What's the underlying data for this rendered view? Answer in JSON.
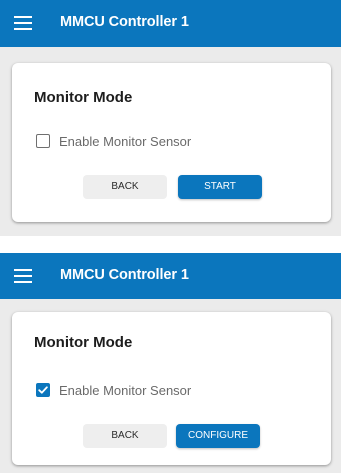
{
  "colors": {
    "primary": "#0b76bd",
    "background": "#ebebeb",
    "card": "#ffffff"
  },
  "screens": [
    {
      "app_bar": {
        "menu_icon": "hamburger-menu-icon",
        "title": "MMCU Controller 1"
      },
      "card": {
        "title": "Monitor Mode",
        "checkbox": {
          "label": "Enable Monitor Sensor",
          "checked": false
        },
        "back_label": "BACK",
        "primary_label": "START"
      }
    },
    {
      "app_bar": {
        "menu_icon": "hamburger-menu-icon",
        "title": "MMCU Controller 1"
      },
      "card": {
        "title": "Monitor Mode",
        "checkbox": {
          "label": "Enable Monitor Sensor",
          "checked": true
        },
        "back_label": "BACK",
        "primary_label": "CONFIGURE"
      }
    }
  ]
}
